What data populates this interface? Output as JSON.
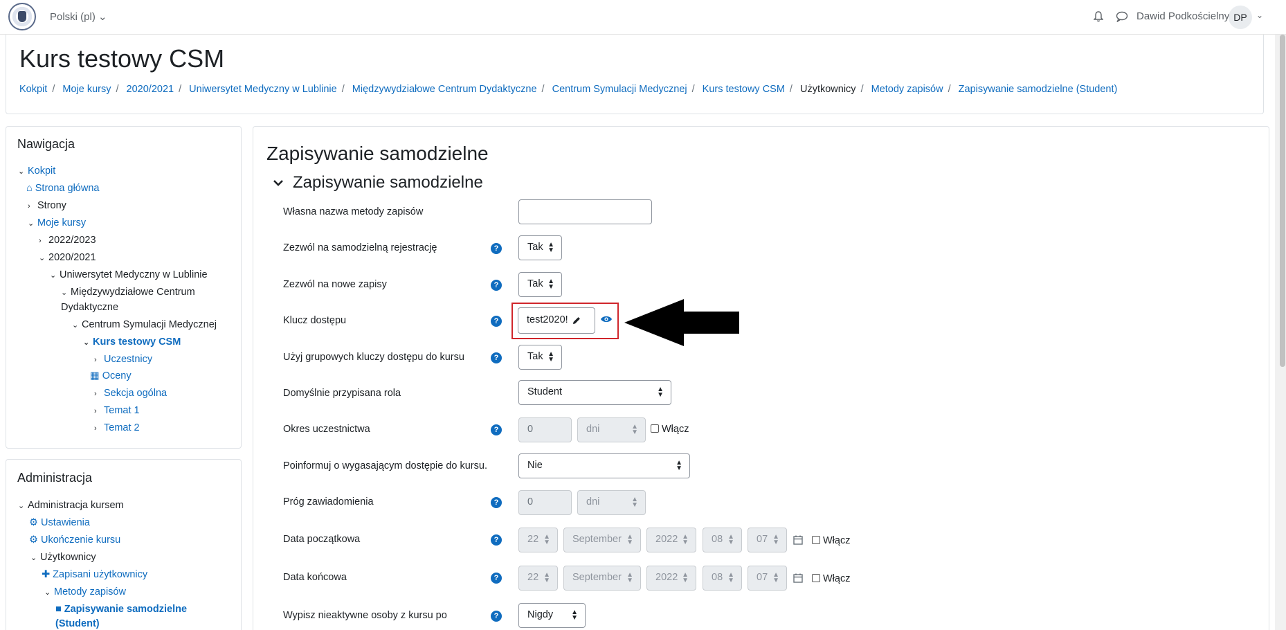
{
  "navbar": {
    "language": "Polski (pl) ⌄",
    "user_name": "Dawid Podkościelny",
    "avatar_initials": "DP",
    "avatar_caret": "⌄",
    "icons": [
      "university-logo-icon",
      "bell-icon",
      "chat-icon"
    ]
  },
  "header": {
    "title": "Kurs testowy CSM",
    "breadcrumb": [
      "Kokpit",
      "Moje kursy",
      "2020/2021",
      "Uniwersytet Medyczny w Lublinie",
      "Międzywydziałowe Centrum Dydaktyczne",
      "Centrum Symulacji Medycznej",
      "Kurs testowy CSM",
      "Użytkownicy",
      "Metody zapisów",
      "Zapisywanie samodzielne (Student)"
    ],
    "separator": "/"
  },
  "navigation": {
    "title": "Nawigacja",
    "items": [
      {
        "label": "Kokpit",
        "chev": "⌄",
        "icon": ""
      },
      {
        "label": "Strona główna",
        "chev": "",
        "icon": "home-icon"
      },
      {
        "label": "Strony",
        "chev": "›",
        "icon": ""
      },
      {
        "label": "Moje kursy",
        "chev": "⌄",
        "icon": ""
      },
      {
        "label": "2022/2023",
        "chev": "›",
        "icon": ""
      },
      {
        "label": "2020/2021",
        "chev": "⌄",
        "icon": ""
      },
      {
        "label": "Uniwersytet Medyczny w Lublinie",
        "chev": "⌄",
        "icon": ""
      },
      {
        "label": "Międzywydziałowe Centrum",
        "chev": "⌄",
        "icon": ""
      },
      {
        "label": "Dydaktyczne",
        "chev": "",
        "icon": ""
      },
      {
        "label": "Centrum Symulacji Medycznej",
        "chev": "⌄",
        "icon": ""
      },
      {
        "label": "Kurs testowy CSM",
        "chev": "⌄",
        "icon": ""
      },
      {
        "label": "Uczestnicy",
        "chev": "›",
        "icon": ""
      },
      {
        "label": "Oceny",
        "chev": "",
        "icon": "table-icon"
      },
      {
        "label": "Sekcja ogólna",
        "chev": "›",
        "icon": ""
      },
      {
        "label": "Temat 1",
        "chev": "›",
        "icon": ""
      },
      {
        "label": "Temat 2",
        "chev": "›",
        "icon": ""
      }
    ]
  },
  "administration": {
    "title": "Administracja",
    "items": [
      {
        "label": "Administracja kursem",
        "chev": "⌄"
      },
      {
        "label": "Ustawienia",
        "chev": ""
      },
      {
        "label": "Ukończenie kursu",
        "chev": ""
      },
      {
        "label": "Użytkownicy",
        "chev": "⌄"
      },
      {
        "label": "Zapisani użytkownicy",
        "chev": ""
      },
      {
        "label": "Metody zapisów",
        "chev": "⌄"
      },
      {
        "label": "Zapisywanie samodzielne",
        "chev": ""
      },
      {
        "label": "(Student)",
        "chev": ""
      }
    ]
  },
  "main": {
    "heading": "Zapisywanie samodzielne",
    "section": "Zapisywanie samodzielne",
    "help_glyph": "?",
    "caret_glyph": "▲▼",
    "fields": {
      "custom_name": {
        "label": "Własna nazwa metody zapisów",
        "value": ""
      },
      "allow_self": {
        "label": "Zezwól na samodzielną rejestrację",
        "value": "Tak"
      },
      "allow_new": {
        "label": "Zezwól na nowe zapisy",
        "value": "Tak"
      },
      "access_key": {
        "label": "Klucz dostępu",
        "value": "test2020!"
      },
      "group_keys": {
        "label": "Użyj grupowych kluczy dostępu do kursu",
        "value": "Tak"
      },
      "default_role": {
        "label": "Domyślnie przypisana rola",
        "value": "Student"
      },
      "enrol_period": {
        "label": "Okres uczestnictwa",
        "value": "0",
        "unit": "dni",
        "enable": "Włącz"
      },
      "notify_expiry": {
        "label": "Poinformuj o wygasającym dostępie do kursu.",
        "value": "Nie"
      },
      "notify_threshold": {
        "label": "Próg zawiadomienia",
        "value": "0",
        "unit": "dni"
      },
      "start_date": {
        "label": "Data początkowa",
        "day": "22",
        "month": "September",
        "year": "2022",
        "hour": "08",
        "minute": "07",
        "enable": "Włącz"
      },
      "end_date": {
        "label": "Data końcowa",
        "day": "22",
        "month": "September",
        "year": "2022",
        "hour": "08",
        "minute": "07",
        "enable": "Włącz"
      },
      "unenrol_inactive": {
        "label": "Wypisz nieaktywne osoby z kursu po",
        "value": "Nigdy"
      }
    }
  },
  "colors": {
    "link": "#0f6cbf",
    "highlight_border": "#d0262b",
    "arrow": "#000000"
  }
}
